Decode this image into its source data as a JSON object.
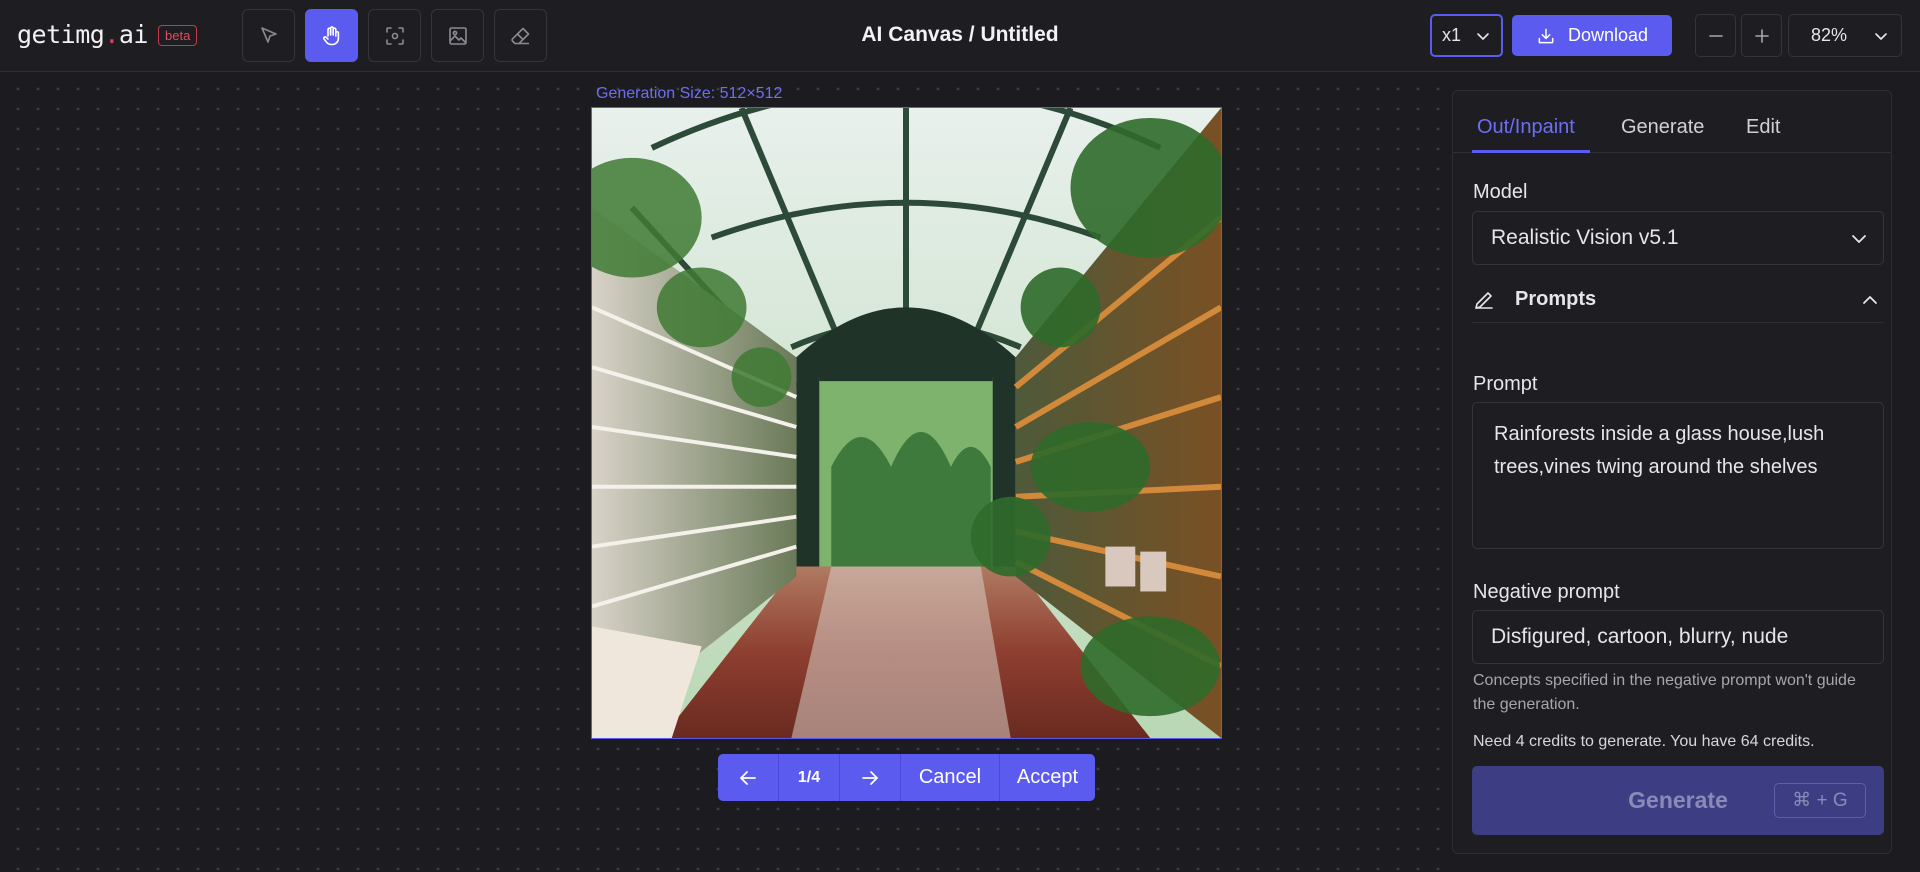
{
  "app": {
    "logo_main": "getimg",
    "logo_dot": ".",
    "logo_tld": "ai",
    "badge": "beta",
    "title": "AI Canvas / Untitled"
  },
  "toolbar": {
    "tools": [
      {
        "name": "select-tool",
        "icon": "pointer-icon",
        "active": false
      },
      {
        "name": "pan-tool",
        "icon": "hand-icon",
        "active": true
      },
      {
        "name": "focus-tool",
        "icon": "focus-icon",
        "active": false
      },
      {
        "name": "image-tool",
        "icon": "image-icon",
        "active": false
      },
      {
        "name": "eraser-tool",
        "icon": "eraser-icon",
        "active": false
      }
    ],
    "scale_value": "x1",
    "download_label": "Download",
    "zoom_value": "82%"
  },
  "canvas": {
    "generation_size": "Generation Size: 512×512",
    "pager": "1/4",
    "cancel_label": "Cancel",
    "accept_label": "Accept"
  },
  "panel": {
    "tabs": [
      "Out/Inpaint",
      "Generate",
      "Edit"
    ],
    "active_tab": "Out/Inpaint",
    "model_label": "Model",
    "model_value": "Realistic Vision v5.1",
    "prompts_section": "Prompts",
    "prompt_label": "Prompt",
    "prompt_value": "Rainforests inside a glass house,lush trees,vines twing around the shelves",
    "negative_label": "Negative prompt",
    "negative_value": "Disfigured, cartoon, blurry, nude",
    "negative_hint": "Concepts specified in the negative prompt won't guide the generation.",
    "credits_text": "Need 4 credits to generate. You have 64 credits.",
    "generate_label": "Generate",
    "generate_shortcut": "⌘ + G"
  },
  "colors": {
    "accent": "#5b5bf0",
    "background": "#1c1c20",
    "badge": "#e24a60"
  }
}
